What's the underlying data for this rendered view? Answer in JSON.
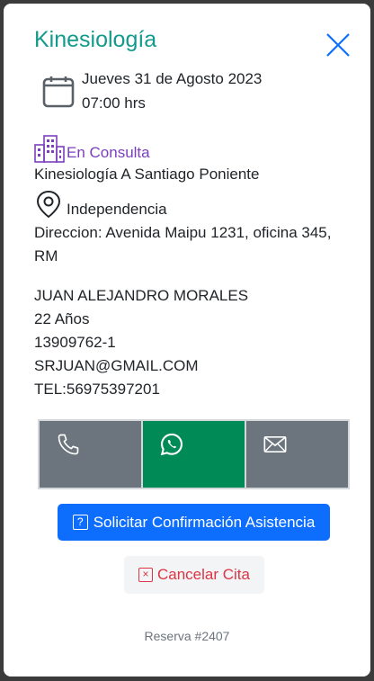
{
  "modal": {
    "title": "Kinesiología",
    "date": "Jueves 31 de Agosto 2023",
    "time": "07:00 hrs",
    "status": "En Consulta",
    "center": "Kinesiología A Santiago Poniente",
    "commune": "Independencia",
    "address_line1": "Direccion: Avenida Maipu 1231, oficina 345,",
    "address_line2": "RM"
  },
  "patient": {
    "name": "JUAN ALEJANDRO MORALES",
    "age": "22 Años",
    "rut": "13909762-1",
    "email": "SRJUAN@GMAIL.COM",
    "phone": "TEL:56975397201"
  },
  "actions": {
    "contact_icons": [
      "phone-icon",
      "whatsapp-icon",
      "envelope-icon"
    ],
    "confirm_label": "Solicitar Confirmación Asistencia",
    "confirm_icon_glyph": "?",
    "cancel_label": "Cancelar Cita",
    "cancel_icon_glyph": "×"
  },
  "footer": {
    "reservation": "Reserva #2407"
  },
  "colors": {
    "title": "#139a8c",
    "status": "#7b3fbe",
    "primary": "#0d6efd",
    "danger": "#dc3545",
    "whatsapp": "#008a56",
    "gray_button": "#6c757d"
  }
}
